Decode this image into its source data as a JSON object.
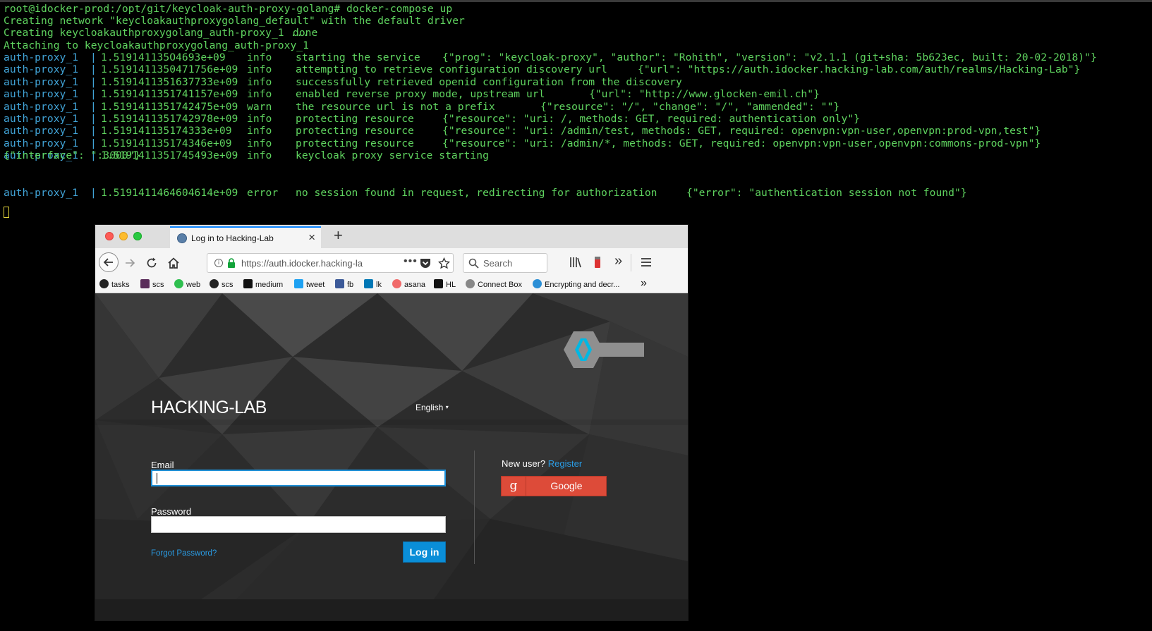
{
  "terminal": {
    "prompt_line": "root@idocker-prod:/opt/git/keycloak-auth-proxy-golang# docker-compose up",
    "network_line": "Creating network \"keycloakauthproxygolang_default\" with the default driver",
    "creating_line": "Creating keycloakauthproxygolang_auth-proxy_1 ... ",
    "creating_done": "done",
    "attaching_line": "Attaching to keycloakauthproxygolang_auth-proxy_1",
    "service": "auth-proxy_1",
    "pipe": "|",
    "logs": [
      {
        "ts": "1.519141135O4693e+09",
        "level": "info",
        "msg": "starting the service",
        "json": "{\"prog\": \"keycloak-proxy\", \"author\": \"Rohith\", \"version\": \"v2.1.1 (git+sha: 5b623ec, built: 20-02-2018)\"}"
      },
      {
        "ts": "1.5191411350471756e+09",
        "level": "info",
        "msg": "attempting to retrieve configuration discovery url",
        "json": "{\"url\": \"https://auth.idocker.hacking-lab.com/auth/realms/Hacking-Lab\"}"
      },
      {
        "ts": "1.5191411351637733e+09",
        "level": "info",
        "msg": "successfully retrieved openid configuration from the discovery",
        "json": ""
      },
      {
        "ts": "1.5191411351741157e+09",
        "level": "info",
        "msg": "enabled reverse proxy mode, upstream url",
        "json": "{\"url\": \"http://www.glocken-emil.ch\"}"
      },
      {
        "ts": "1.5191411351742475e+09",
        "level": "warn",
        "msg": "the resource url is not a prefix",
        "json": "{\"resource\": \"/\", \"change\": \"/\", \"ammended\": \"\"}"
      },
      {
        "ts": "1.5191411351742978e+09",
        "level": "info",
        "msg": "protecting resource",
        "json": "{\"resource\": \"uri: /, methods: GET, required: authentication only\"}"
      },
      {
        "ts": "1.519141135174333e+09",
        "level": "info",
        "msg": "protecting resource",
        "json": "{\"resource\": \"uri: /admin/test, methods: GET, required: openvpn:vpn-user,openvpn:prod-vpn,test\"}"
      },
      {
        "ts": "1.519141135174346e+09",
        "level": "info",
        "msg": "protecting resource",
        "json": "{\"resource\": \"uri: /admin/*, methods: GET, required: openvpn:vpn-user,openvpn:commons-prod-vpn\"}"
      },
      {
        "ts": "1.5191411351745493e+09",
        "level": "info",
        "msg": "keycloak proxy service starting",
        "json": "{\"interface\": \":3000\"}"
      }
    ],
    "error_log": {
      "ts": "1.5191411464604614e+09",
      "level": "error",
      "msg": "no session found in request, redirecting for authorization",
      "json": "{\"error\": \"authentication session not found\"}"
    }
  },
  "browser": {
    "tab_title": "Log in to Hacking-Lab",
    "new_tab": "+",
    "url": "https://auth.idocker.hacking-la",
    "url_more": "•••",
    "search_placeholder": "Search",
    "overflow": "»",
    "bookmarks": [
      "tasks",
      "scs",
      "web",
      "scs",
      "medium",
      "tweet",
      "fb",
      "lk",
      "asana",
      "HL",
      "Connect Box",
      "Encrypting and decr..."
    ],
    "bookmark_overflow": "»"
  },
  "login": {
    "brand": "HACKING-LAB",
    "language": "English",
    "email_label": "Email",
    "email_value": "",
    "password_label": "Password",
    "forgot": "Forgot Password?",
    "login_button": "Log in",
    "new_user": "New user?",
    "register": "Register",
    "google_icon_letter": "g",
    "google_button": "Google"
  },
  "colors": {
    "terminal_text": "#5fd35f",
    "terminal_service": "#41a3d6",
    "link": "#2a9be3",
    "login_button": "#0a8ed8",
    "google_button": "#dd4b39"
  }
}
